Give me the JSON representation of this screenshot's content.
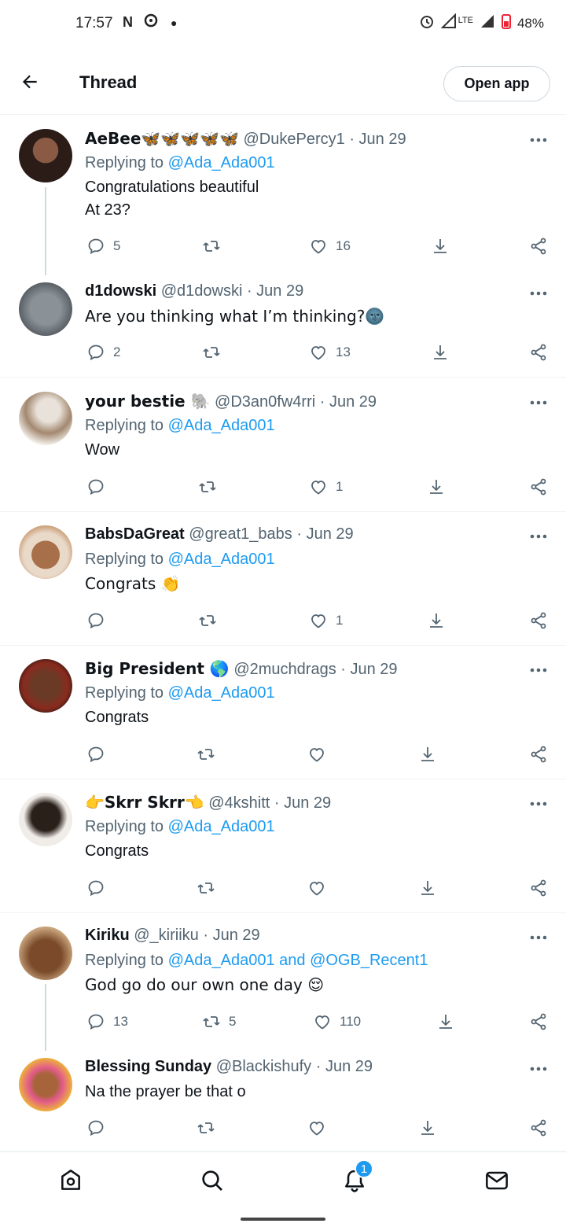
{
  "status_bar": {
    "time": "17:57",
    "network": "LTE",
    "battery": "48%"
  },
  "header": {
    "title": "Thread",
    "open_app_label": "Open app"
  },
  "tweets": [
    {
      "name": "AeBee🦋🦋🦋🦋🦋",
      "handle": "@DukePercy1",
      "date": "· Jun 29",
      "replying_label": "Replying to ",
      "replying_to": "@Ada_Ada001",
      "text_lines": [
        "Congratulations beautiful",
        "At 23?"
      ],
      "replies": "5",
      "retweets": "",
      "likes": "16",
      "avatar_color": "#3a2a25"
    },
    {
      "name": "d1dowski",
      "handle": "@d1dowski",
      "date": "· Jun 29",
      "replying_label": "",
      "replying_to": "",
      "text_lines": [
        "Are you thinking what I’m thinking?🌚"
      ],
      "replies": "2",
      "retweets": "",
      "likes": "13",
      "avatar_color": "#6b737a"
    },
    {
      "name": "your bestie 🐘",
      "handle": "@D3an0fw4rri",
      "date": "· Jun 29",
      "replying_label": "Replying to ",
      "replying_to": "@Ada_Ada001",
      "text_lines": [
        "Wow"
      ],
      "replies": "",
      "retweets": "",
      "likes": "1",
      "avatar_color": "#c9b9a6"
    },
    {
      "name": "BabsDaGreat",
      "handle": "@great1_babs",
      "date": "· Jun 29",
      "replying_label": "Replying to ",
      "replying_to": "@Ada_Ada001",
      "text_lines": [
        "Congrats 👏"
      ],
      "replies": "",
      "retweets": "",
      "likes": "1",
      "avatar_color": "#8a5a3a"
    },
    {
      "name": "Big President 🌎",
      "handle": "@2muchdrags",
      "date": "· Jun 29",
      "replying_label": "Replying to ",
      "replying_to": "@Ada_Ada001",
      "text_lines": [
        "Congrats"
      ],
      "replies": "",
      "retweets": "",
      "likes": "",
      "avatar_color": "#5a3322"
    },
    {
      "name": "👉Skrr Skrr👈",
      "handle": "@4kshitt",
      "date": "· Jun 29",
      "replying_label": "Replying to ",
      "replying_to": "@Ada_Ada001",
      "text_lines": [
        "Congrats"
      ],
      "replies": "",
      "retweets": "",
      "likes": "",
      "avatar_color": "#2a2420"
    },
    {
      "name": "Kiriku",
      "handle": "@_kiriiku",
      "date": "· Jun 29",
      "replying_label": "Replying to ",
      "replying_to": "@Ada_Ada001 and @OGB_Recent1",
      "text_lines": [
        "God go do our own one day 😌"
      ],
      "replies": "13",
      "retweets": "5",
      "likes": "110",
      "avatar_color": "#7a4a2a"
    },
    {
      "name": "Blessing Sunday",
      "handle": "@Blackishufy",
      "date": "· Jun 29",
      "replying_label": "",
      "replying_to": "",
      "text_lines": [
        "Na the prayer be that o"
      ],
      "replies": "",
      "retweets": "",
      "likes": "",
      "avatar_color": "#d4a030"
    }
  ],
  "bottom_nav": {
    "notifications_badge": "1"
  }
}
